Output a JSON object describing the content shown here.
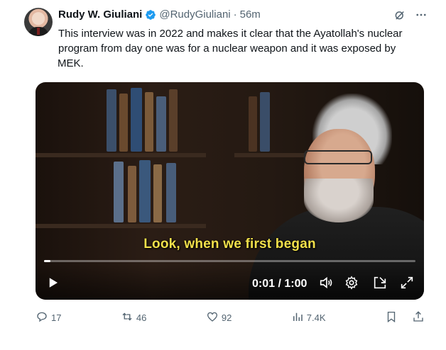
{
  "author": {
    "name": "Rudy W. Giuliani",
    "handle": "@RudyGiuliani",
    "separator": "·",
    "time": "56m"
  },
  "tweet": {
    "line1": "This interview was in 2022 and makes it clear that the Ayatollah's nuclear",
    "line2": "program from day one was for a nuclear weapon and it was exposed by",
    "line3": "MEK."
  },
  "video": {
    "caption": "Look, when we first began",
    "time_display": "0:01 / 1:00",
    "progress": 0.017
  },
  "actions": {
    "replies": "17",
    "reposts": "46",
    "likes": "92",
    "views": "7.4K"
  },
  "colors": {
    "text": "#0f1419",
    "muted": "#536471",
    "verified": "#1d9bf0",
    "caption": "#f1e04a"
  }
}
